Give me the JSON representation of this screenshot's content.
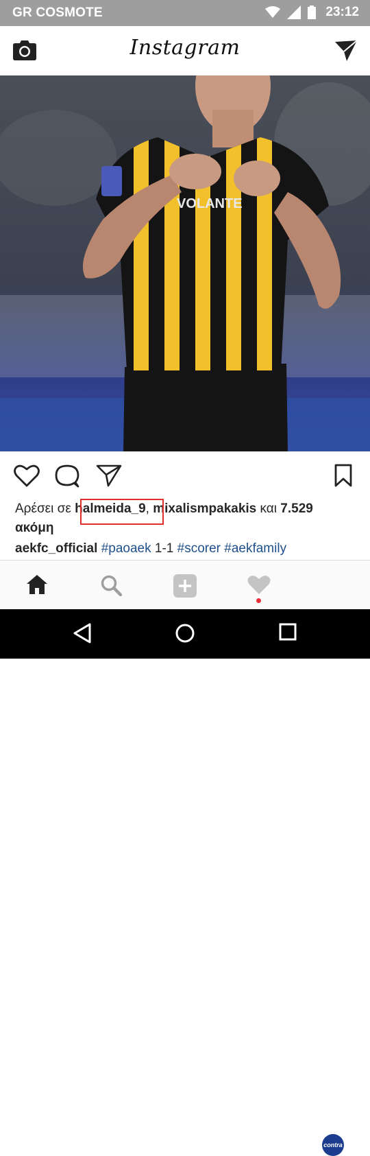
{
  "status_bar": {
    "carrier": "GR COSMOTE",
    "time": "23:12",
    "icons": [
      "wifi-icon",
      "signal-icon",
      "battery-icon"
    ]
  },
  "header": {
    "app_name": "Instagram",
    "left_icon": "camera-icon",
    "right_icon": "direct-send-icon"
  },
  "post": {
    "jersey_text": "VOLANTE",
    "actions": [
      "like-icon",
      "comment-icon",
      "share-icon",
      "save-icon"
    ],
    "likes": {
      "prefix": "Αρέσει σε",
      "user1": "halmeida_9",
      "separator": ",",
      "user2": "mixalismpakakis",
      "conj": "και",
      "count": "7.529",
      "suffix": "ακόμη"
    },
    "caption": {
      "user": "aekfc_official",
      "hashtag1": "#paoaek",
      "score": "1-1",
      "hashtag2": "#scorer",
      "hashtag3": "#aekfamily"
    }
  },
  "bottom_nav": {
    "items": [
      "home-icon",
      "search-icon",
      "add-post-icon",
      "activity-heart-icon",
      "profile-avatar"
    ],
    "avatar_text": "contra"
  },
  "android_nav": [
    "back-icon",
    "home-circle-icon",
    "recents-icon"
  ],
  "colors": {
    "status_bar": "#9e9e9e",
    "hashtag": "#1f4f8a",
    "highlight_box": "#e0302c",
    "notification_dot": "#e8303a",
    "jersey_yellow": "#f2c02b"
  }
}
